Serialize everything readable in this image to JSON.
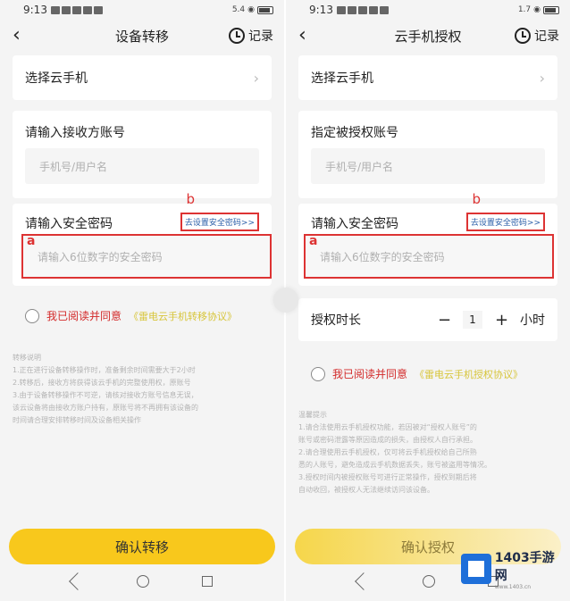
{
  "status": {
    "time": "9:13",
    "network_left": "5.4",
    "network_right": "1.7"
  },
  "left": {
    "nav": {
      "title": "设备转移",
      "record": "记录"
    },
    "select_phone": "选择云手机",
    "receiver_label": "请输入接收方账号",
    "receiver_placeholder": "手机号/用户名",
    "password_label": "请输入安全密码",
    "set_password_link": "去设置安全密码>>",
    "password_placeholder": "请输入6位数字的安全密码",
    "mark_a": "a",
    "mark_b": "b",
    "agree_text": "我已阅读并同意",
    "agree_link": "《雷电云手机转移协议》",
    "notes": [
      "转移说明",
      "1.正在进行设备转移操作时，准备剩余时间需要大于2小时",
      "2.转移后，接收方将获得该云手机的完整使用权，原账号",
      "3.由于设备转移操作不可逆，请核对接收方账号信息无误，",
      "该云设备将由接收方账户持有，原账号将不再拥有该设备的",
      "时间请合理安排转移时间及设备相关操作"
    ],
    "confirm": "确认转移"
  },
  "right": {
    "nav": {
      "title": "云手机授权",
      "record": "记录"
    },
    "select_phone": "选择云手机",
    "receiver_label": "指定被授权账号",
    "receiver_placeholder": "手机号/用户名",
    "password_label": "请输入安全密码",
    "set_password_link": "去设置安全密码>>",
    "password_placeholder": "请输入6位数字的安全密码",
    "mark_a": "a",
    "mark_b": "b",
    "duration_label": "授权时长",
    "duration_value": "1",
    "duration_minus": "−",
    "duration_plus": "+",
    "duration_unit": "小时",
    "agree_text": "我已阅读并同意",
    "agree_link": "《雷电云手机授权协议》",
    "notes": [
      "温馨提示",
      "1.请合法使用云手机授权功能，若因被对“授权人账号”的",
      "账号或密码泄露等原因造成的损失，由授权人自行承担。",
      "2.请合理使用云手机授权，仅可将云手机授权给自己所熟",
      "悉的人账号，避免造成云手机数据丢失，账号被盗用等情况。",
      "3.授权时间内被授权账号可进行正常操作，授权到期后将",
      "自动收回，被授权人无法继续访问该设备。"
    ],
    "confirm": "确认授权"
  },
  "watermark": {
    "name": "1403手游网",
    "url": "www.1403.cn"
  }
}
